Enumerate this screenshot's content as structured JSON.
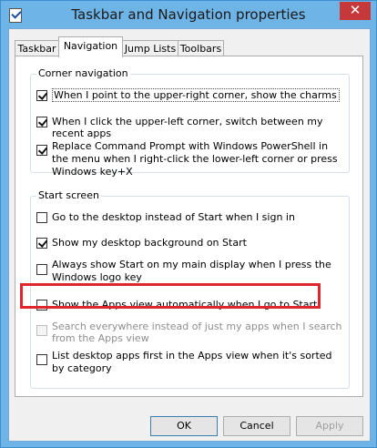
{
  "window": {
    "title": "Taskbar and Navigation properties",
    "close_glyph": "✕"
  },
  "tabs": [
    {
      "label": "Taskbar"
    },
    {
      "label": "Navigation"
    },
    {
      "label": "Jump Lists"
    },
    {
      "label": "Toolbars"
    }
  ],
  "corner_navigation": {
    "title": "Corner navigation",
    "options": [
      {
        "label": "When I point to the upper-right corner, show the charms",
        "checked": true
      },
      {
        "label": "When I click the upper-left corner, switch between my recent apps",
        "checked": true
      },
      {
        "label": "Replace Command Prompt with Windows PowerShell in the menu when I right-click the lower-left corner or press Windows key+X",
        "checked": true
      }
    ]
  },
  "start_screen": {
    "title": "Start screen",
    "options": [
      {
        "label": "Go to the desktop instead of Start when I sign in",
        "checked": false,
        "disabled": false
      },
      {
        "label": "Show my desktop background on Start",
        "checked": true,
        "disabled": false
      },
      {
        "label": "Always show Start on my main display when I press the Windows logo key",
        "checked": false,
        "disabled": false
      },
      {
        "label": "Show the Apps view automatically when I go to Start",
        "checked": false,
        "disabled": false
      },
      {
        "label": "Search everywhere instead of just my apps when I search from the Apps view",
        "checked": false,
        "disabled": true
      },
      {
        "label": "List desktop apps first in the Apps view when it's sorted by category",
        "checked": false,
        "disabled": false
      }
    ]
  },
  "buttons": {
    "ok": "OK",
    "cancel": "Cancel",
    "apply": "Apply"
  },
  "colors": {
    "highlight": "#e0262d",
    "close": "#c7383a",
    "frame": "#6fb4e6"
  }
}
